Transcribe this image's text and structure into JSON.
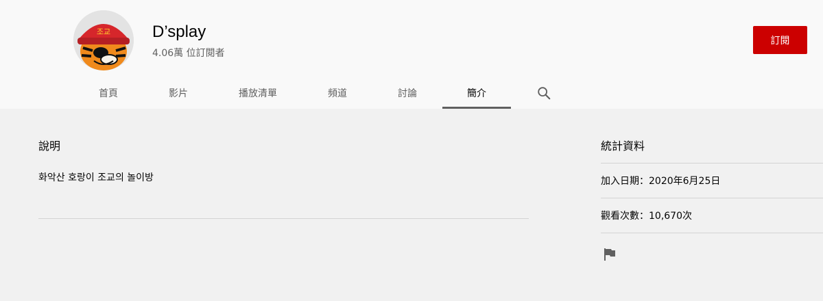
{
  "channel": {
    "name": "D’splay",
    "subscribers": "4.06萬 位訂閱者",
    "subscribe_label": "訂閱",
    "avatar_label": "조교"
  },
  "tabs": [
    {
      "label": "首頁"
    },
    {
      "label": "影片"
    },
    {
      "label": "播放清單"
    },
    {
      "label": "頻道"
    },
    {
      "label": "討論"
    },
    {
      "label": "簡介",
      "active": true
    }
  ],
  "about": {
    "description_title": "說明",
    "description_text": "화악산 호랑이 조교의 놀이방"
  },
  "stats": {
    "title": "統計資料",
    "joined": "加入日期：2020年6月25日",
    "views": "觀看次數：10,670次"
  },
  "icons": {
    "search": "search-icon",
    "flag": "flag-icon"
  },
  "colors": {
    "subscribe": "#cc0000",
    "header_bg": "#f9f9f9",
    "page_bg": "#f1f1f1"
  }
}
